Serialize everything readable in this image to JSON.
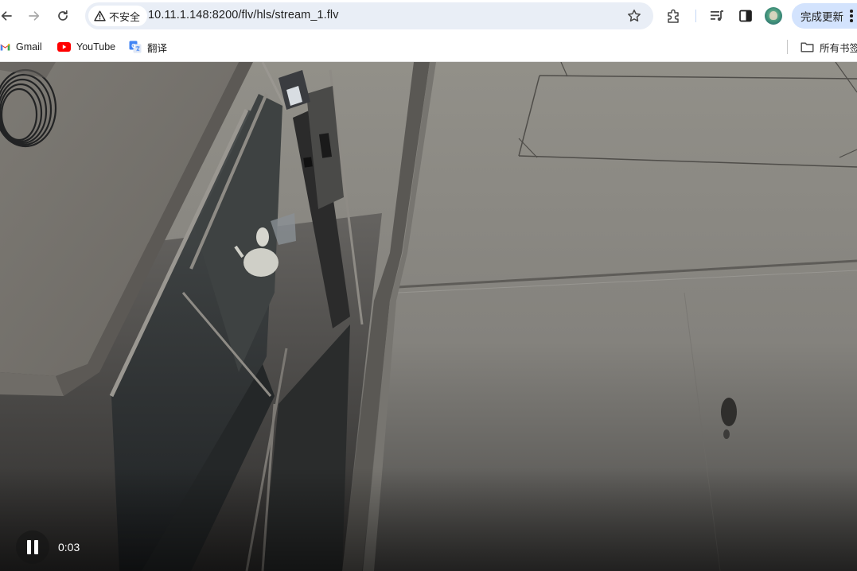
{
  "toolbar": {
    "security_label": "不安全",
    "url": "10.11.1.148:8200/flv/hls/stream_1.flv",
    "update_label": "完成更新"
  },
  "icons": {
    "back": "arrow-left-icon",
    "forward": "arrow-right-icon",
    "reload": "reload-icon",
    "warning": "warning-triangle-icon",
    "bookmark_star": "star-icon",
    "extensions": "puzzle-icon",
    "media": "media-queue-icon",
    "side_panel": "side-panel-icon",
    "profile": "avatar",
    "menu": "kebab-menu-icon",
    "folder": "folder-icon"
  },
  "bookmarks": {
    "items": [
      {
        "label": "Gmail",
        "icon": "gmail-icon"
      },
      {
        "label": "YouTube",
        "icon": "youtube-icon"
      },
      {
        "label": "翻译",
        "icon": "translate-icon"
      }
    ],
    "all_bookmarks_label": "所有书签"
  },
  "player": {
    "state": "playing",
    "current_time": "0:03"
  },
  "colors": {
    "omnibox_bg": "#e9eef6",
    "update_button_bg": "#d3e3fd",
    "youtube_red": "#ff0000",
    "video_floor": "#8f8d89"
  }
}
